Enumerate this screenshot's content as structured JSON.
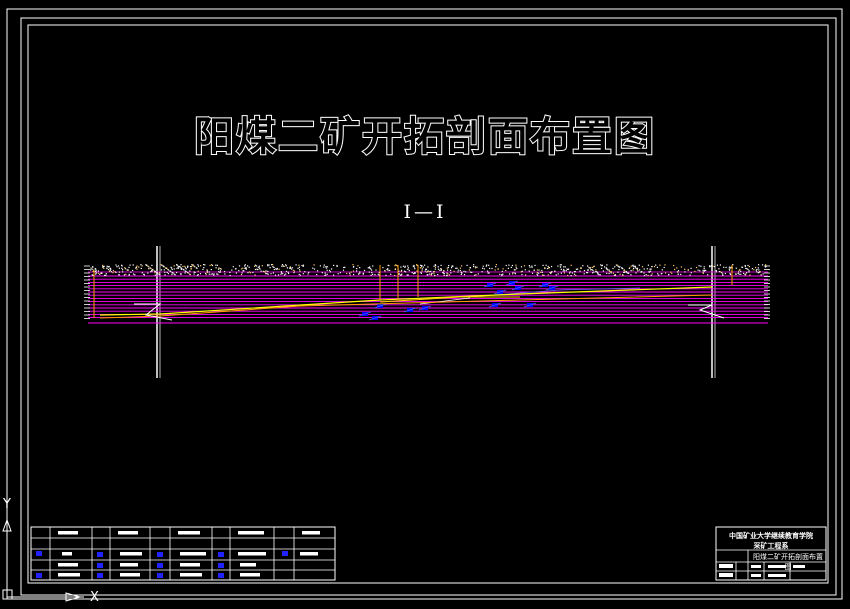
{
  "drawing": {
    "title": "阳煤二矿开拓剖面布置图",
    "section_label": "Ⅰ—Ⅰ",
    "title_block": {
      "school": "中国矿业大学继续教育学院",
      "department": "采矿工程系",
      "drawing_name": "阳煤二矿开拓剖面布置图"
    },
    "ucs": {
      "x_label": "X",
      "y_label": "Y"
    }
  },
  "colors": {
    "background": "#000000",
    "frame": "#ffffff",
    "strata": "#ff00ff",
    "coal_seam": "#ffff00",
    "roadway": "#ff9900",
    "workings": "#0000ff"
  }
}
